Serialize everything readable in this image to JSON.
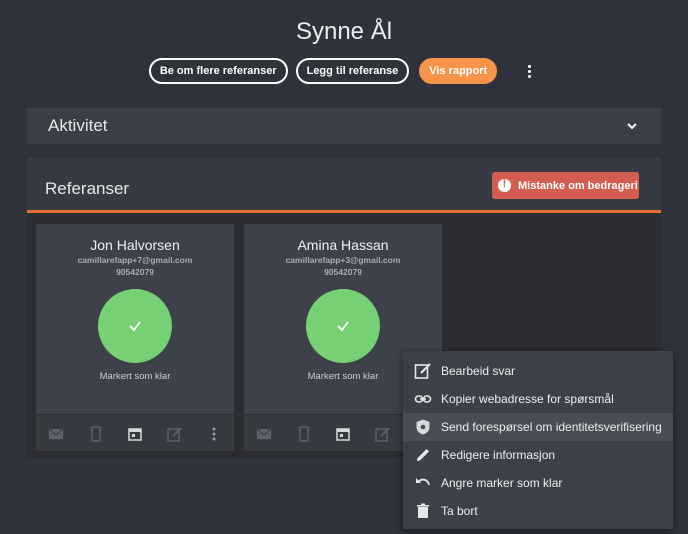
{
  "header": {
    "title": "Synne Ål",
    "buttons": {
      "request_more": "Be om flere referanser",
      "add_reference": "Legg til referanse",
      "show_report": "Vis rapport"
    }
  },
  "aktivitet": {
    "label": "Aktivitet"
  },
  "referanser": {
    "label": "Referanser",
    "fraud_button": "Mistanke om bedrageri",
    "cards": [
      {
        "name": "Jon Halvorsen",
        "email": "camillarefapp+7@gmail.com",
        "phone": "90542079",
        "status": "Markert som klar"
      },
      {
        "name": "Amina Hassan",
        "email": "camillarefapp+3@gmail.com",
        "phone": "90542079",
        "status": "Markert som klar"
      }
    ]
  },
  "context_menu": {
    "items": [
      {
        "label": "Bearbeid svar",
        "icon": "edit-note-icon"
      },
      {
        "label": "Kopier webadresse for spørsmål",
        "icon": "link-icon"
      },
      {
        "label": "Send forespørsel om identitetsverifisering",
        "icon": "shield-icon"
      },
      {
        "label": "Redigere informasjon",
        "icon": "pencil-icon"
      },
      {
        "label": "Angre marker som klar",
        "icon": "undo-icon"
      },
      {
        "label": "Ta bort",
        "icon": "trash-icon"
      }
    ],
    "highlighted_index": 2
  },
  "colors": {
    "accent_orange": "#f6944a",
    "fraud_red": "#d45d52",
    "success_green": "#76d174",
    "divider_orange": "#e46a36"
  }
}
